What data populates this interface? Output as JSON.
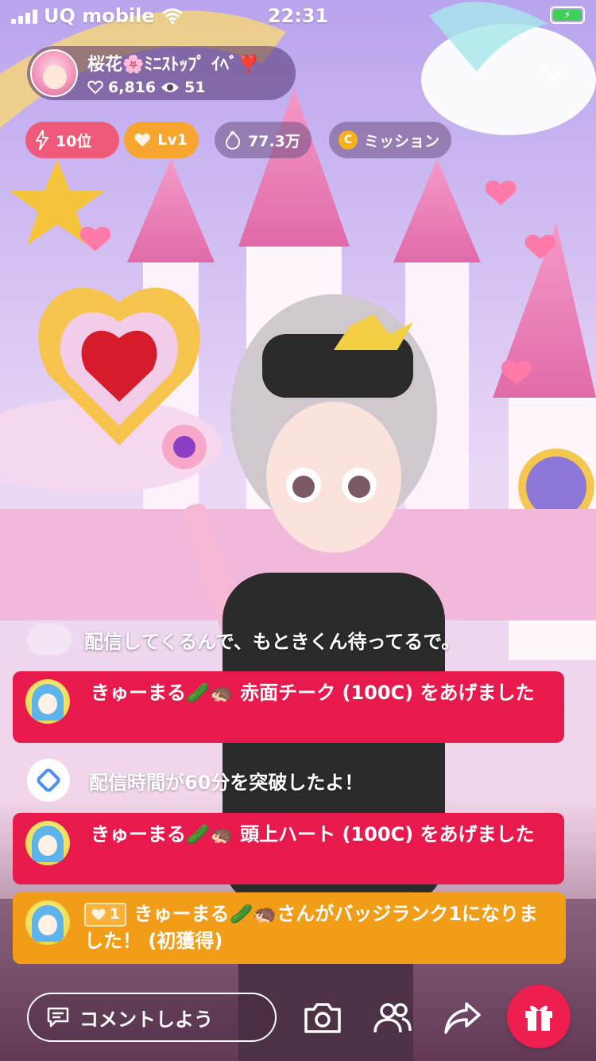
{
  "status_bar": {
    "carrier": "UQ mobile",
    "time": "22:31"
  },
  "host": {
    "name": "桜花🌸ﾐﾆｽﾄｯﾌﾟ ｲﾍﾞ❣️",
    "likes": "6,816",
    "viewers": "51"
  },
  "pills": {
    "rank": "10位",
    "level": "Lv1",
    "points": "77.3万",
    "mission": "ミッション",
    "coin_letter": "C"
  },
  "chat": {
    "plain_message": "配信してくるんで、もときくん待ってるで。",
    "gift_1": "きゅーまる🥒🦔 赤面チーク (100C) をあげました",
    "system_message": "配信時間が60分を突破したよ！",
    "gift_2": "きゅーまる🥒🦔 頭上ハート (100C) をあげました",
    "badge_level": "1",
    "badge_message": "きゅーまる🥒🦔さんがバッジランク1になりました！ (初獲得)"
  },
  "bottom_bar": {
    "comment_placeholder": "コメントしよう"
  },
  "colors": {
    "gift_message": "#e8194c",
    "badge_message": "#f19d18",
    "rank_pill": "#ef5a7a",
    "level_pill": "#f6a52e",
    "gift_button": "#ee1e4e"
  },
  "icons": {
    "signal": "signal-icon",
    "wifi": "wifi-icon",
    "battery": "battery-charging-icon",
    "heart": "heart-icon",
    "eye": "eye-icon",
    "collapse": "chevron-down-icon",
    "rank": "lightning-icon",
    "level": "heart-badge-icon",
    "points": "flame-icon",
    "comment": "comment-icon",
    "camera": "camera-icon",
    "people": "people-icon",
    "share": "share-icon",
    "gift": "gift-icon"
  }
}
